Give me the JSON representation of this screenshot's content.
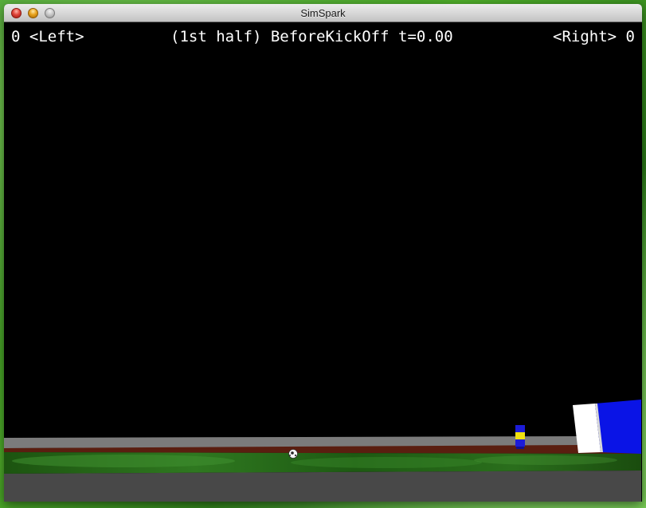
{
  "window": {
    "title": "SimSpark"
  },
  "hud": {
    "left_score": "0",
    "left_team": "<Left>",
    "half": "(1st half)",
    "play_mode": "BeforeKickOff",
    "time": "t=0.00",
    "right_team": "<Right>",
    "right_score": "0"
  },
  "colors": {
    "field": "#1f5a14",
    "sky": "#000000",
    "border": "#7d7d7d",
    "goal_blue": "#0a14e6",
    "goal_white": "#ffffff",
    "player_blue": "#1c1cd8",
    "player_yellow": "#f0e010"
  }
}
